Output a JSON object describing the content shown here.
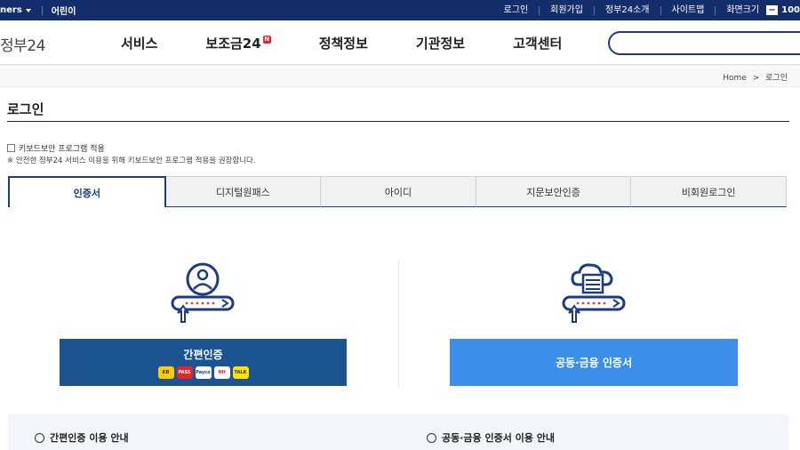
{
  "topbar": {
    "lang_label": "ners",
    "kids_label": "어린이",
    "links": [
      "로그인",
      "회원가입",
      "정부24소개",
      "사이트맵"
    ],
    "zoom_label": "화면크기",
    "zoom_minus": "−",
    "zoom_value": "100"
  },
  "header": {
    "logo": "정부24",
    "nav": [
      {
        "label": "서비스"
      },
      {
        "label": "보조금24",
        "badge": "N"
      },
      {
        "label": "정책정보"
      },
      {
        "label": "기관정보"
      },
      {
        "label": "고객센터"
      }
    ],
    "search_placeholder": ""
  },
  "breadcrumb": {
    "home": "Home",
    "sep": ">",
    "current": "로그인"
  },
  "page": {
    "title": "로그인",
    "keyboard_security_label": "키보드보안 프로그램 적용",
    "notice": "※ 안전한 정부24 서비스 이용을 위해 키보드보안 프로그램 적용을 권장합니다."
  },
  "tabs": [
    {
      "label": "인증서",
      "active": true
    },
    {
      "label": "디지털원패스",
      "active": false
    },
    {
      "label": "아이디",
      "active": false
    },
    {
      "label": "지문보안인증",
      "active": false
    },
    {
      "label": "비회원로그인",
      "active": false
    }
  ],
  "cards": {
    "simple_auth_label": "간편인증",
    "simple_auth_logos": [
      "KB",
      "PASS",
      "Payco",
      "NH",
      "TALK"
    ],
    "joint_cert_label": "공동·금융 인증서"
  },
  "info": {
    "simple_guide": "간편인증 이용 안내",
    "joint_guide": "공동·금융 인증서 이용 안내"
  },
  "colors": {
    "topbar": "#142d6b",
    "simple_button": "#1b5393",
    "joint_button": "#3d8ee8",
    "accent": "#1c3b86"
  }
}
